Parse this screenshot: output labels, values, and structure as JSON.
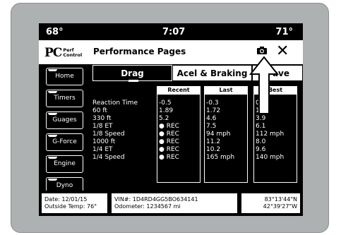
{
  "status_bar": {
    "temp_left": "68°",
    "time": "7:07",
    "temp_right": "71°"
  },
  "header": {
    "logo_main": "PC",
    "logo_line1": "Perf",
    "logo_line2": "Control",
    "title": "Performance Pages",
    "camera_icon": "camera-icon",
    "close_symbol": "✕"
  },
  "nav": {
    "items": [
      "Home",
      "Timers",
      "Guages",
      "G-Force",
      "Engine",
      "Dyno"
    ]
  },
  "tabs": {
    "drag": "Drag",
    "accel": "Acel & Braking",
    "save": "ave"
  },
  "table": {
    "labels": [
      "Reaction Time",
      "60 ft",
      "330 ft",
      "1/8 ET",
      "1/8 Speed",
      "1000 ft",
      "1/4 ET",
      "1/4 Speed"
    ],
    "columns": [
      {
        "header": "Recent",
        "values": [
          "-0.5",
          "1.89",
          "5.2",
          "● REC",
          "● REC",
          "● REC",
          "● REC",
          "● REC"
        ]
      },
      {
        "header": "Last",
        "values": [
          "-0.3",
          "1.72",
          "4.6",
          "7.5",
          "94 mph",
          "11.2",
          "10.2",
          "165 mph"
        ]
      },
      {
        "header": "Best",
        "values": [
          "0.23",
          "1.36",
          "3.9",
          "6.1",
          "112 mph",
          "8.0",
          "9.6",
          "140 mph"
        ]
      }
    ]
  },
  "footer": {
    "date": "Date: 12/01/15",
    "outside_temp": "Outside Temp: 76°",
    "vin": "VIN#: 1D4RD4GG5BO634141",
    "odometer": "Odometer: 1234567 mi",
    "lat": "83°13'44\"N",
    "lon": "42°39'27\"W"
  },
  "colors": {
    "screen_bg": "#000000",
    "bezel": "#aeb1b1",
    "text": "#ffffff"
  }
}
